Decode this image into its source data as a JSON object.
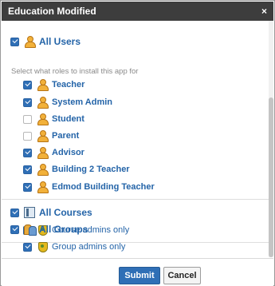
{
  "dialog": {
    "title": "Education Modified",
    "close": "×"
  },
  "users": {
    "all_label": "All Users",
    "help_text": "Select what roles to install this app for",
    "roles": [
      {
        "label": "Teacher",
        "checked": true
      },
      {
        "label": "System Admin",
        "checked": true
      },
      {
        "label": "Student",
        "checked": false
      },
      {
        "label": "Parent",
        "checked": false
      },
      {
        "label": "Advisor",
        "checked": true
      },
      {
        "label": "Building 2 Teacher",
        "checked": true
      },
      {
        "label": "Edmod Building Teacher",
        "checked": true
      }
    ]
  },
  "courses": {
    "all_label": "All Courses",
    "admins_label": "Course admins only"
  },
  "groups": {
    "all_label": "All Groups",
    "admins_label": "Group admins only"
  },
  "buttons": {
    "submit": "Submit",
    "cancel": "Cancel"
  },
  "colors": {
    "titlebar": "#3d3d3d",
    "accent": "#2f6fb6",
    "label": "#2464a8"
  }
}
